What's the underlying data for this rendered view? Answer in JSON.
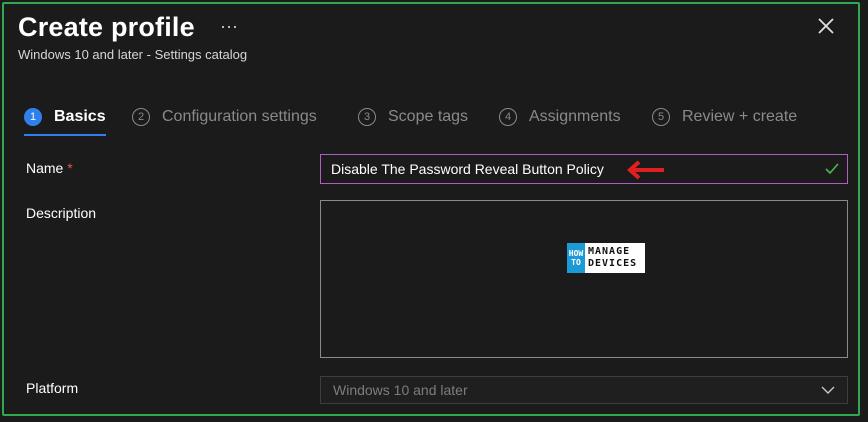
{
  "header": {
    "title": "Create profile",
    "ellipsis": "···",
    "subtitle": "Windows 10 and later - Settings catalog"
  },
  "steps": [
    {
      "num": "1",
      "label": "Basics",
      "active": true
    },
    {
      "num": "2",
      "label": "Configuration settings",
      "active": false
    },
    {
      "num": "3",
      "label": "Scope tags",
      "active": false
    },
    {
      "num": "4",
      "label": "Assignments",
      "active": false
    },
    {
      "num": "5",
      "label": "Review + create",
      "active": false
    }
  ],
  "form": {
    "name_label": "Name",
    "required_mark": "*",
    "name_value": "Disable The Password Reveal Button Policy",
    "description_label": "Description",
    "description_value": "",
    "platform_label": "Platform",
    "platform_value": "Windows 10 and later"
  },
  "watermark": {
    "how": "HOW",
    "to": "TO",
    "manage": "MANAGE",
    "devices": "DEVICES"
  },
  "colors": {
    "frame_border": "#2fa84f",
    "accent": "#2f80ed",
    "name_border": "#b05fc0",
    "required": "#e0564f",
    "check": "#4fb84f",
    "arrow": "#e02020"
  },
  "icons": {
    "close": "close-icon",
    "check": "check-icon",
    "arrow": "red-arrow-icon",
    "chevron": "chevron-down-icon"
  }
}
